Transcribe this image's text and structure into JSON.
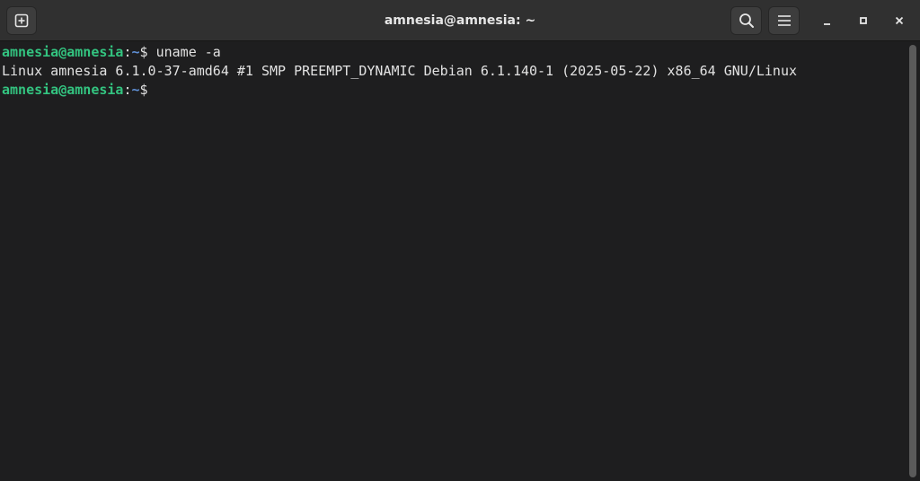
{
  "window": {
    "title": "amnesia@amnesia: ~"
  },
  "header": {
    "icons": {
      "new_tab": "new-tab-icon",
      "search": "search-icon",
      "menu": "hamburger-menu-icon",
      "minimize": "minimize-icon",
      "maximize": "maximize-icon",
      "close": "close-icon"
    }
  },
  "terminal": {
    "lines": [
      {
        "user": "amnesia@amnesia",
        "sep": ":",
        "path": "~",
        "symbol": "$ ",
        "text": "uname -a"
      },
      {
        "output": "Linux amnesia 6.1.0-37-amd64 #1 SMP PREEMPT_DYNAMIC Debian 6.1.140-1 (2025-05-22) x86_64 GNU/Linux"
      },
      {
        "user": "amnesia@amnesia",
        "sep": ":",
        "path": "~",
        "symbol": "$ ",
        "text": ""
      }
    ]
  },
  "colors": {
    "background": "#1e1e1f",
    "header": "#303030",
    "prompt_user": "#33c480",
    "prompt_path": "#5f8fd4",
    "text": "#e2e2e2"
  }
}
